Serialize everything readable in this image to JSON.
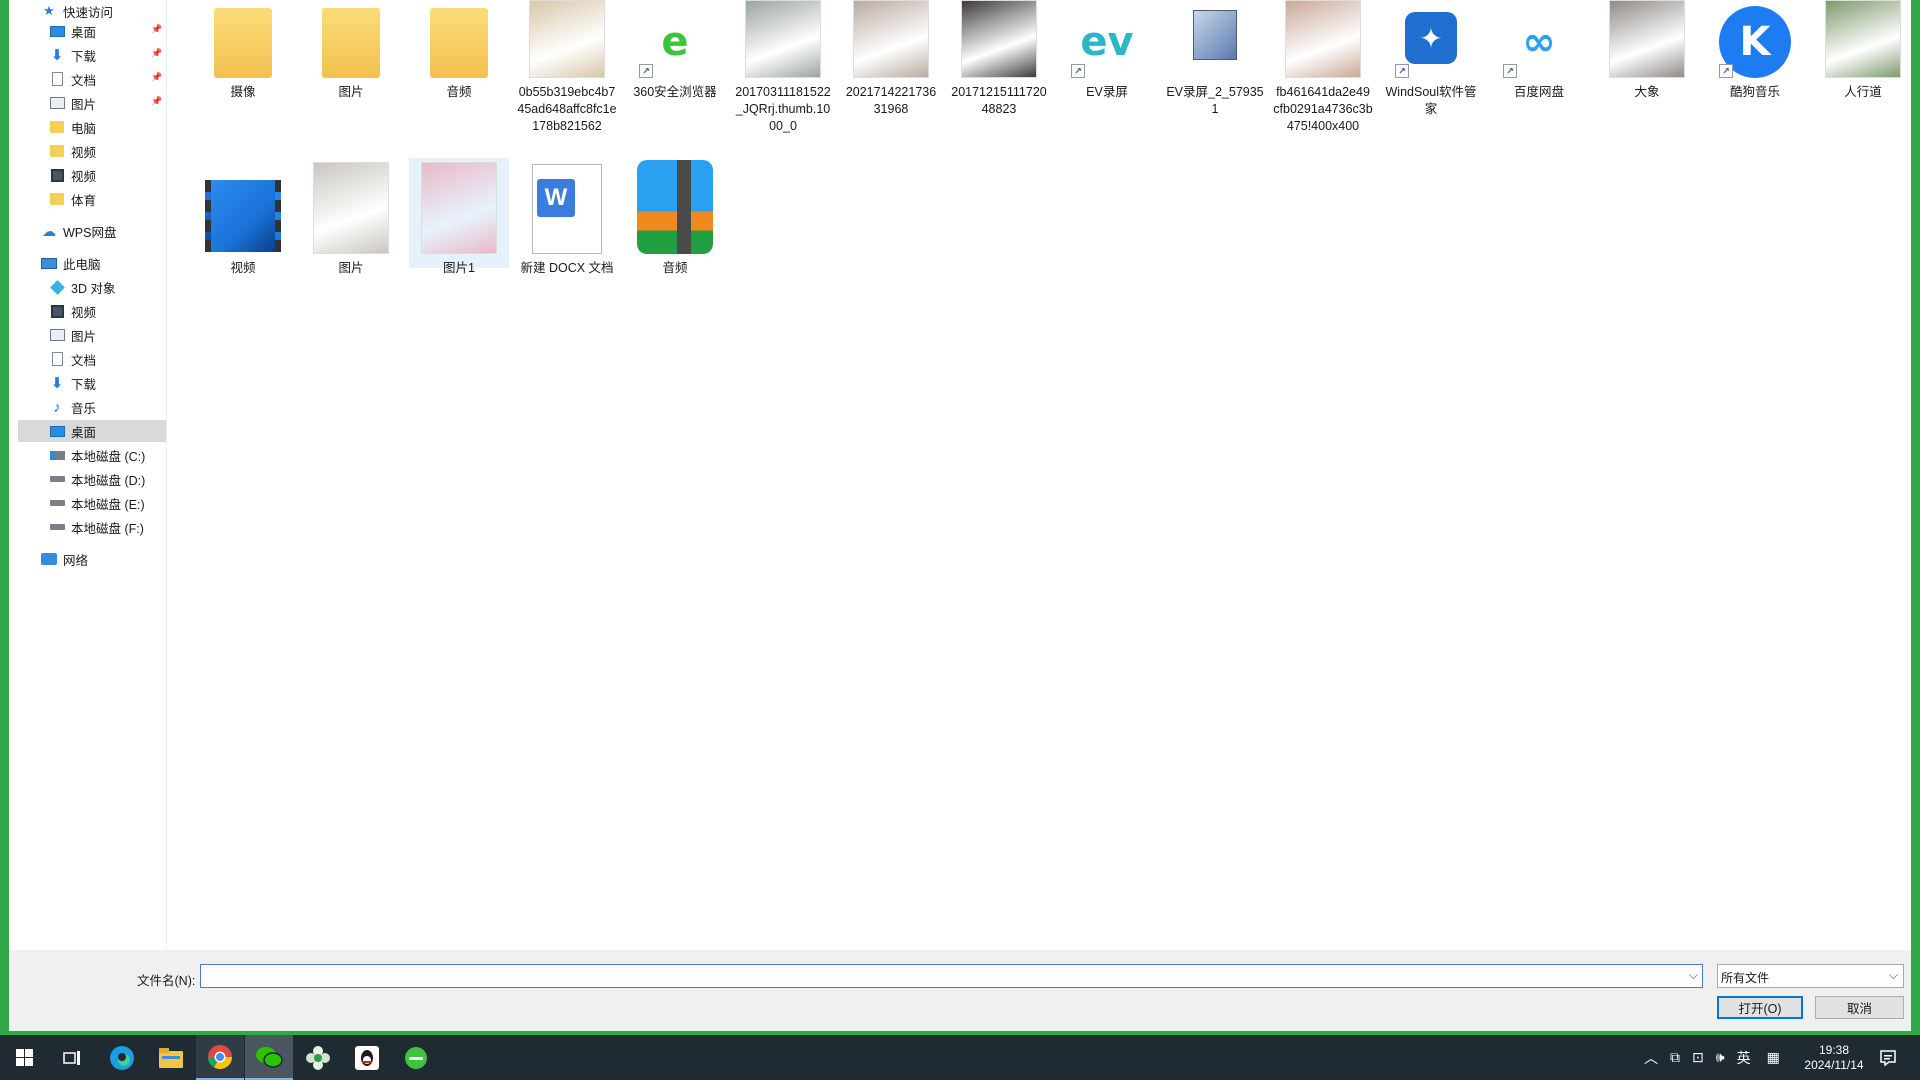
{
  "nav": {
    "items": [
      {
        "label": "快速访问",
        "icon": "star-icon"
      },
      {
        "label": "桌面",
        "icon": "desktop-icon",
        "pinned": true
      },
      {
        "label": "下载",
        "icon": "download-icon",
        "pinned": true
      },
      {
        "label": "文档",
        "icon": "document-icon",
        "pinned": true
      },
      {
        "label": "图片",
        "icon": "picture-icon",
        "pinned": true
      },
      {
        "label": "电脑",
        "icon": "folder-icon"
      },
      {
        "label": "视频",
        "icon": "folder-icon"
      },
      {
        "label": "视频",
        "icon": "video-icon"
      },
      {
        "label": "体育",
        "icon": "folder-icon"
      },
      {
        "label": "WPS网盘",
        "icon": "cloud-icon"
      },
      {
        "label": "此电脑",
        "icon": "computer-icon"
      },
      {
        "label": "3D 对象",
        "icon": "3d-objects-icon"
      },
      {
        "label": "视频",
        "icon": "video-icon"
      },
      {
        "label": "图片",
        "icon": "picture-icon"
      },
      {
        "label": "文档",
        "icon": "document-icon"
      },
      {
        "label": "下载",
        "icon": "download-icon"
      },
      {
        "label": "音乐",
        "icon": "music-icon"
      },
      {
        "label": "桌面",
        "icon": "desktop-icon",
        "selected": true
      },
      {
        "label": "本地磁盘 (C:)",
        "icon": "drive-c-icon"
      },
      {
        "label": "本地磁盘 (D:)",
        "icon": "drive-icon"
      },
      {
        "label": "本地磁盘 (E:)",
        "icon": "drive-icon"
      },
      {
        "label": "本地磁盘 (F:)",
        "icon": "drive-icon"
      },
      {
        "label": "网络",
        "icon": "network-icon"
      }
    ]
  },
  "files": [
    {
      "name": "摄像",
      "kind": "folder"
    },
    {
      "name": "图片",
      "kind": "folder"
    },
    {
      "name": "音频",
      "kind": "folder"
    },
    {
      "name": "0b55b319ebc4b745ad648affc8fc1e178b821562",
      "kind": "photo",
      "color": "#d9c7a8"
    },
    {
      "name": "360安全浏览器",
      "kind": "app",
      "color": "#3cc43c",
      "glyph": "e",
      "shortcut": true
    },
    {
      "name": "20170311181522_JQRrj.thumb.1000_0",
      "kind": "photo",
      "color": "#9aa4a0"
    },
    {
      "name": "2021714221736 31968",
      "kind": "photo",
      "color": "#b9aba0"
    },
    {
      "name": "2017121511172048823",
      "kind": "photo",
      "color": "#3e3a3a"
    },
    {
      "name": "EV录屏",
      "kind": "app",
      "color": "#2cb7c9",
      "glyph": "ev",
      "shortcut": true
    },
    {
      "name": "EV录屏_2_579351",
      "kind": "installer",
      "color": "#5a7ab0"
    },
    {
      "name": "fb461641da2e49cfb0291a4736c3b475!400x400",
      "kind": "photo",
      "color": "#caa898"
    },
    {
      "name": "WindSoul软件管家",
      "kind": "app",
      "color": "#1e6fd0",
      "glyph": "✦",
      "shortcut": true
    },
    {
      "name": "百度网盘",
      "kind": "app",
      "color": "#2f9ff0",
      "glyph": "∞",
      "shortcut": true
    },
    {
      "name": "大象",
      "kind": "photo",
      "color": "#8f8b86"
    },
    {
      "name": "酷狗音乐",
      "kind": "app",
      "color": "#1d7cf2",
      "glyph": "K",
      "shortcut": true
    },
    {
      "name": "人行道",
      "kind": "photo",
      "color": "#7d9a6d"
    },
    {
      "name": "视频",
      "kind": "video",
      "color": "#1a73d9"
    },
    {
      "name": "图片",
      "kind": "photo",
      "color": "#c9c6bd"
    },
    {
      "name": "图片1",
      "kind": "photo",
      "color": "#e8b9c9",
      "hover": true
    },
    {
      "name": "新建 DOCX 文档",
      "kind": "docx",
      "color": "#3b7ddc"
    },
    {
      "name": "音频",
      "kind": "archive",
      "color": "#1e8fe0"
    }
  ],
  "bottom": {
    "filename_label": "文件名(N):",
    "filename_value": "",
    "filter_value": "所有文件",
    "open_label": "打开(O)",
    "cancel_label": "取消"
  },
  "taskbar": {
    "time": "19:38",
    "date": "2024/11/14",
    "ime": "英"
  }
}
